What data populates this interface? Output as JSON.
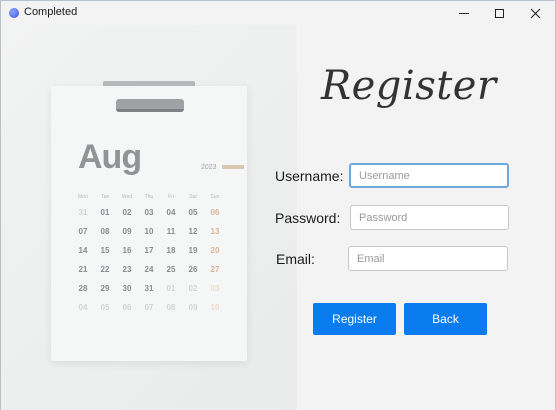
{
  "window": {
    "title": "Completed"
  },
  "photo": {
    "month": "Aug",
    "year": "2023",
    "weekdays": [
      "Mon",
      "Tue",
      "Wed",
      "Thu",
      "Fri",
      "Sat",
      "Sun"
    ],
    "weeks": [
      [
        "31",
        "01",
        "02",
        "03",
        "04",
        "05",
        "06"
      ],
      [
        "07",
        "08",
        "09",
        "10",
        "11",
        "12",
        "13"
      ],
      [
        "14",
        "15",
        "16",
        "17",
        "18",
        "19",
        "20"
      ],
      [
        "21",
        "22",
        "23",
        "24",
        "25",
        "26",
        "27"
      ],
      [
        "28",
        "29",
        "30",
        "31",
        "01",
        "02",
        "03"
      ],
      [
        "04",
        "05",
        "06",
        "07",
        "08",
        "09",
        "10"
      ]
    ]
  },
  "form": {
    "heading": "Register",
    "username_label": "Username:",
    "username_placeholder": "Username",
    "password_label": "Password:",
    "password_placeholder": "Password",
    "email_label": "Email:",
    "email_placeholder": "Email",
    "register_button": "Register",
    "back_button": "Back"
  },
  "colors": {
    "accent": "#0a7cf0",
    "focus_border": "#6fa8dc"
  }
}
